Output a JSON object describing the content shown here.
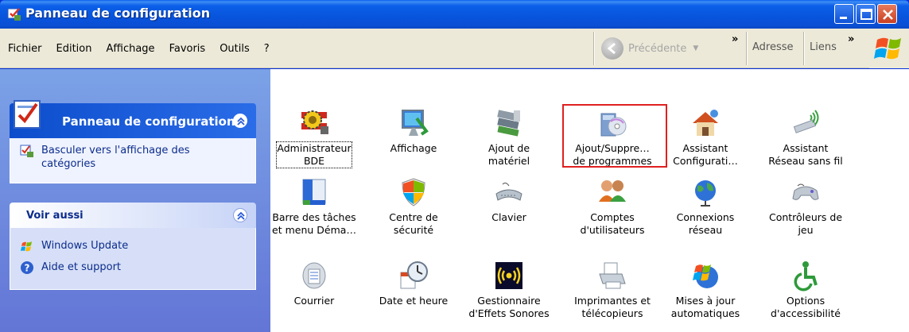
{
  "window": {
    "title": "Panneau de configuration"
  },
  "menu": [
    "Fichier",
    "Edition",
    "Affichage",
    "Favoris",
    "Outils",
    "?"
  ],
  "toolbar": {
    "back_label": "Précédente",
    "address_label": "Adresse",
    "links_label": "Liens"
  },
  "sidebar": {
    "panel_title": "Panneau de configuration",
    "switch_view_line1": "Basculer vers l'affichage des",
    "switch_view_line2": "catégories",
    "see_also_title": "Voir aussi",
    "see_also_items": [
      "Windows Update",
      "Aide et support"
    ]
  },
  "items": [
    {
      "line1": "Administrateur",
      "line2": "BDE"
    },
    {
      "line1": "Affichage",
      "line2": ""
    },
    {
      "line1": "Ajout de",
      "line2": "matériel"
    },
    {
      "line1": "Ajout/Suppre…",
      "line2": "de programmes"
    },
    {
      "line1": "Assistant",
      "line2": "Configurati…"
    },
    {
      "line1": "Assistant",
      "line2": "Réseau sans fil"
    },
    {
      "line1": "Barre des tâches",
      "line2": "et menu Déma…"
    },
    {
      "line1": "Centre de",
      "line2": "sécurité"
    },
    {
      "line1": "Clavier",
      "line2": ""
    },
    {
      "line1": "Comptes",
      "line2": "d'utilisateurs"
    },
    {
      "line1": "Connexions",
      "line2": "réseau"
    },
    {
      "line1": "Contrôleurs de",
      "line2": "jeu"
    },
    {
      "line1": "Courrier",
      "line2": ""
    },
    {
      "line1": "Date et heure",
      "line2": ""
    },
    {
      "line1": "Gestionnaire",
      "line2": "d'Effets Sonores"
    },
    {
      "line1": "Imprimantes et",
      "line2": "télécopieurs"
    },
    {
      "line1": "Mises à jour",
      "line2": "automatiques"
    },
    {
      "line1": "Options",
      "line2": "d'accessibilité"
    }
  ],
  "colors": {
    "titlebar": "#0854dc",
    "highlight": "#e02020",
    "link": "#0c2c8c"
  }
}
